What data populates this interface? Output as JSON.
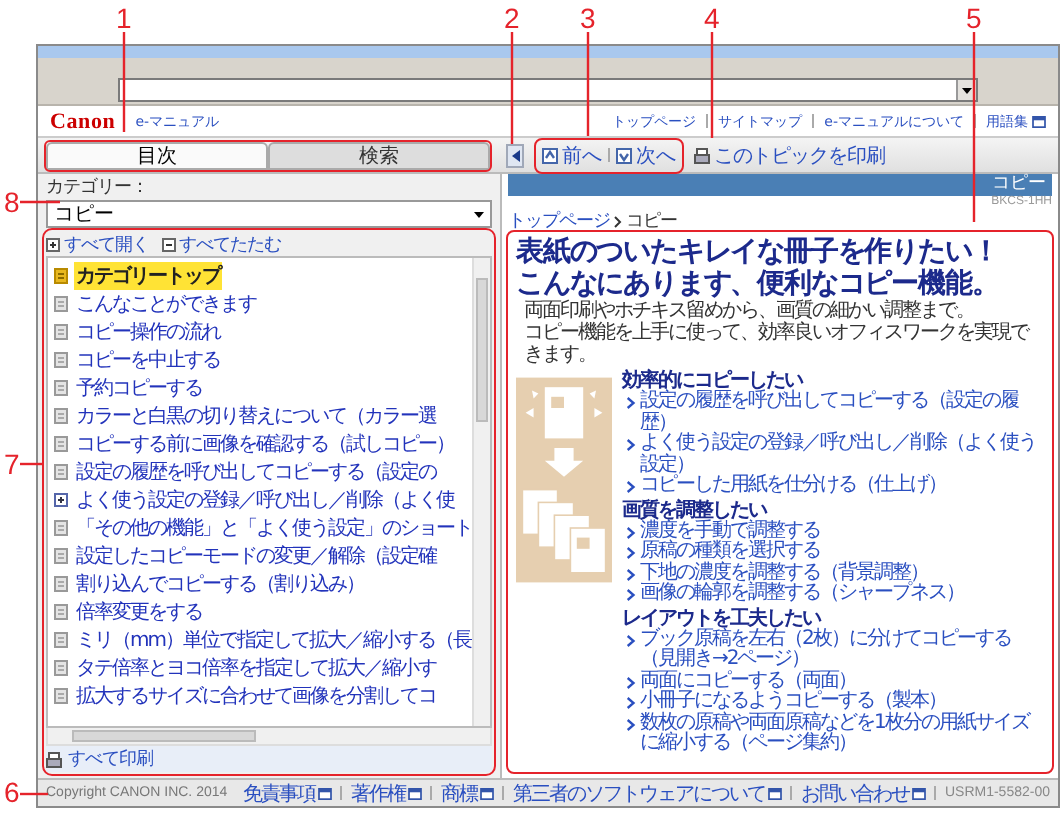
{
  "callouts": [
    {
      "label": "1"
    },
    {
      "label": "2"
    },
    {
      "label": "3"
    },
    {
      "label": "4"
    },
    {
      "label": "5"
    },
    {
      "label": "8"
    },
    {
      "label": "7"
    },
    {
      "label": "6"
    }
  ],
  "header": {
    "logo": "Canon",
    "product": "e-マニュアル",
    "links": [
      "トップページ",
      "サイトマップ",
      "e-マニュアルについて",
      "用語集"
    ]
  },
  "tabs": [
    {
      "label": "目次",
      "selected": true
    },
    {
      "label": "検索",
      "selected": false
    }
  ],
  "toolbar": {
    "prev": "前へ",
    "next": "次へ",
    "print": "このトピックを印刷"
  },
  "sidebar": {
    "category_label": "カテゴリー：",
    "category": "コピー",
    "expand_all": "すべて開く",
    "collapse_all": "すべてたたむ",
    "print_all": "すべて印刷",
    "items": [
      {
        "label": "カテゴリートップ",
        "kind": "page",
        "selected": true
      },
      {
        "label": "こんなことができます",
        "kind": "page",
        "selected": false
      },
      {
        "label": "コピー操作の流れ",
        "kind": "page",
        "selected": false
      },
      {
        "label": "コピーを中止する",
        "kind": "page",
        "selected": false
      },
      {
        "label": "予約コピーする",
        "kind": "page",
        "selected": false
      },
      {
        "label": "カラーと白黒の切り替えについて（カラー選",
        "kind": "page",
        "selected": false
      },
      {
        "label": "コピーする前に画像を確認する（試しコピー）",
        "kind": "page",
        "selected": false
      },
      {
        "label": "設定の履歴を呼び出してコピーする（設定の",
        "kind": "page",
        "selected": false
      },
      {
        "label": "よく使う設定の登録／呼び出し／削除（よく使",
        "kind": "group",
        "selected": false
      },
      {
        "label": "「その他の機能」と「よく使う設定」のショート",
        "kind": "page",
        "selected": false
      },
      {
        "label": "設定したコピーモードの変更／解除（設定確",
        "kind": "page",
        "selected": false
      },
      {
        "label": "割り込んでコピーする（割り込み）",
        "kind": "page",
        "selected": false
      },
      {
        "label": "倍率変更をする",
        "kind": "page",
        "selected": false
      },
      {
        "label": "ミリ（mm）単位で指定して拡大／縮小する（長",
        "kind": "page",
        "selected": false
      },
      {
        "label": "タテ倍率とヨコ倍率を指定して拡大／縮小す",
        "kind": "page",
        "selected": false
      },
      {
        "label": "拡大するサイズに合わせて画像を分割してコ",
        "kind": "page",
        "selected": false
      }
    ]
  },
  "main": {
    "section": "コピー",
    "code": "BKCS-1HH",
    "breadcrumb": [
      "トップページ",
      "コピー"
    ],
    "title": [
      "表紙のついたキレイな冊子を作りたい！",
      "こんなにあります、便利なコピー機能。"
    ],
    "intro": [
      "両面印刷やホチキス留めから、画質の細かい調整まで。",
      "コピー機能を上手に使って、効率良いオフィスワークを実現できます。"
    ],
    "groups": [
      {
        "heading": "効率的にコピーしたい",
        "links": [
          "設定の履歴を呼び出してコピーする（設定の履歴）",
          "よく使う設定の登録／呼び出し／削除（よく使う設定）",
          "コピーした用紙を仕分ける（仕上げ）"
        ]
      },
      {
        "heading": "画質を調整したい",
        "links": [
          "濃度を手動で調整する",
          "原稿の種類を選択する",
          "下地の濃度を調整する（背景調整）",
          "画像の輪郭を調整する（シャープネス）"
        ]
      },
      {
        "heading": "レイアウトを工夫したい",
        "links": [
          "ブック原稿を左右（2枚）に分けてコピーする（見開き→2ページ）",
          "両面にコピーする（両面）",
          "小冊子になるようコピーする（製本）",
          "数枚の原稿や両面原稿などを1枚分の用紙サイズに縮小する（ページ集約）"
        ]
      }
    ]
  },
  "footer": {
    "copyright": "Copyright CANON INC. 2014",
    "links": [
      "免責事項",
      "著作権",
      "商標",
      "第三者のソフトウェアについて",
      "お問い合わせ"
    ],
    "code": "USRM1-5582-00"
  }
}
